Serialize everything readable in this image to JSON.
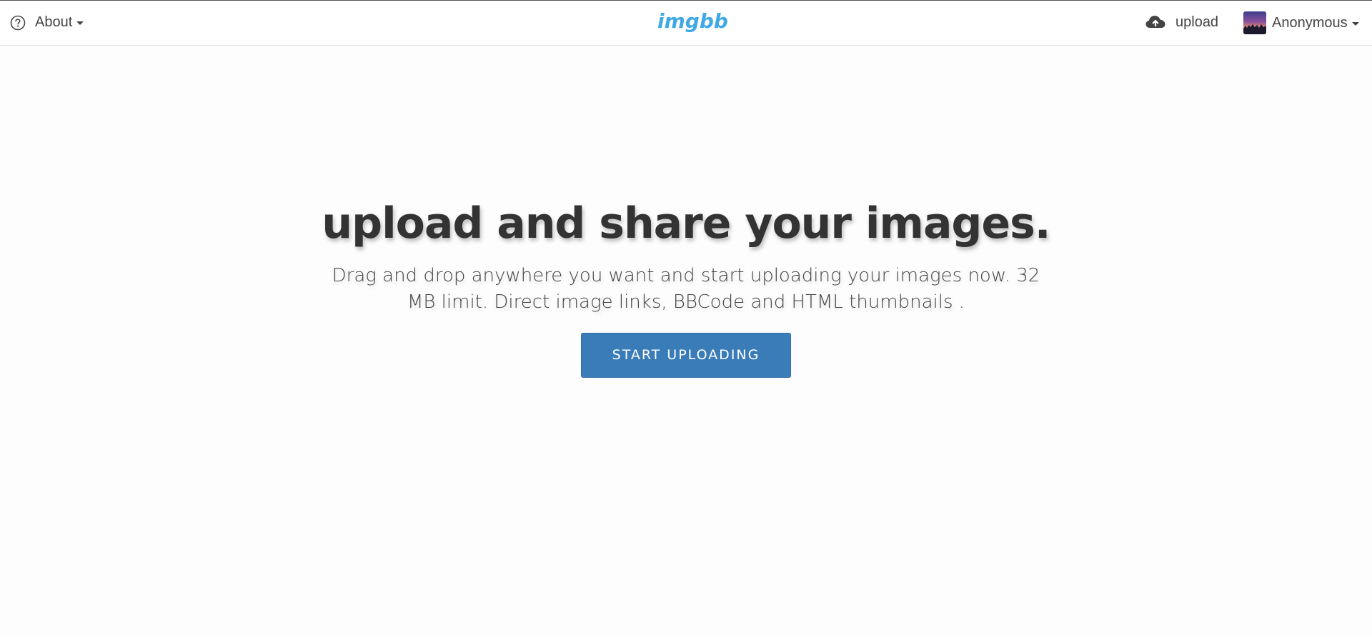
{
  "header": {
    "about_label": "About",
    "logo_text": "imgbb",
    "upload_label": "upload",
    "user_label": "Anonymous"
  },
  "hero": {
    "title": "upload and share your images.",
    "subtitle": "Drag and drop anywhere you want and start uploading your images now. 32 MB limit. Direct image links, BBCode and HTML thumbnails .",
    "button_label": "START UPLOADING"
  },
  "colors": {
    "brand": "#3fa9e6",
    "button": "#3a7cb8",
    "text": "#333333"
  },
  "icons": {
    "help": "help-circle-icon",
    "upload": "cloud-upload-icon",
    "dropdown": "caret-down-icon"
  }
}
